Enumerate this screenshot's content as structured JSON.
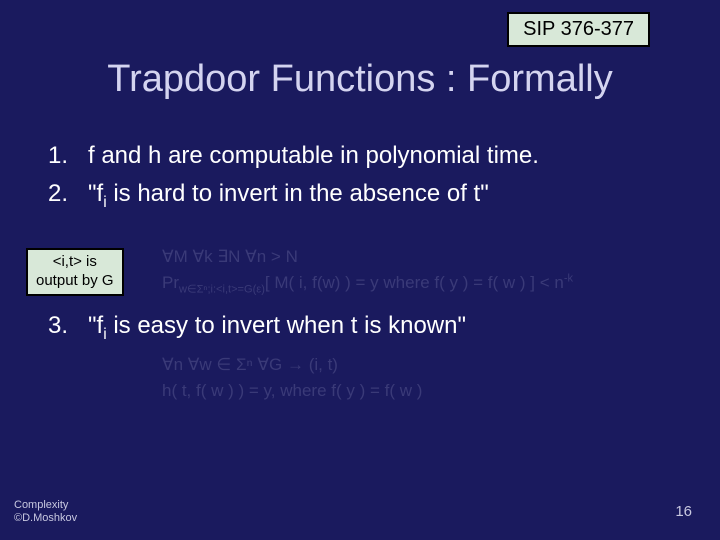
{
  "ref": "SIP 376-377",
  "title": "Trapdoor Functions : Formally",
  "items": {
    "n1": "1.",
    "t1": "f and h are computable in polynomial time.",
    "n2": "2.",
    "t2_pre": "\"f",
    "t2_sub": "i",
    "t2_post": " is hard to invert in the absence of t\"",
    "n3": "3.",
    "t3_pre": "\"f",
    "t3_sub": "i",
    "t3_post": " is easy to invert when t is known\""
  },
  "note": {
    "l1": "<i,t> is",
    "l2": "output by G"
  },
  "formula1": {
    "l1": "∀M  ∀k  ∃N  ∀n > N",
    "l2_a": "Pr",
    "l2_b": "w∈Σⁿ;i:<i,t>=G(ε)",
    "l2_c": "[ M( i, f(w) ) = y where f( y ) = f( w ) ] < n",
    "l2_d": "-k"
  },
  "formula2": {
    "l1": "∀n  ∀w ∈ Σⁿ  ∀G → (i, t)",
    "l2": "h( t, f( w ) ) = y,  where f( y ) = f( w )"
  },
  "footer": {
    "l1": "Complexity",
    "l2": "©D.Moshkov"
  },
  "page": "16"
}
